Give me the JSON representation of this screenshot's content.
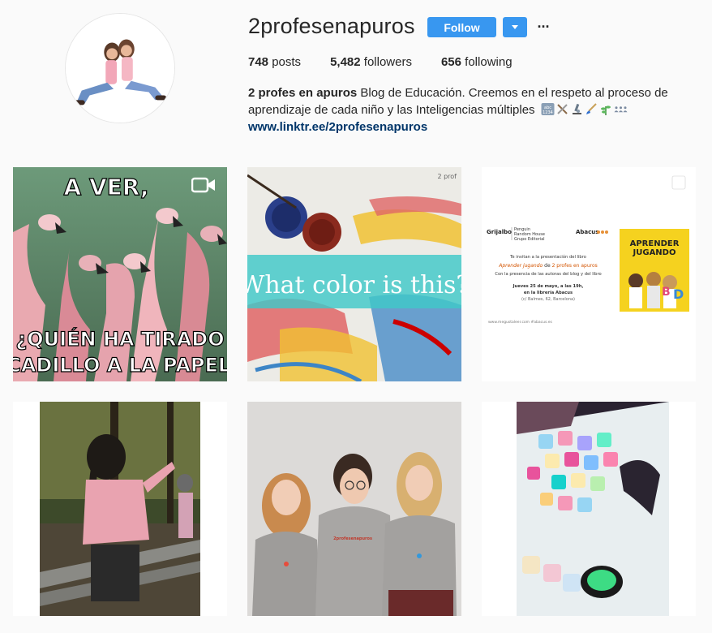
{
  "profile": {
    "username": "2profesenapuros",
    "follow_label": "Follow",
    "more_label": "···",
    "stats": {
      "posts_count": "748",
      "posts_label": "posts",
      "followers_count": "5,482",
      "followers_label": "followers",
      "following_count": "656",
      "following_label": "following"
    },
    "bio": {
      "name": "2 profes en apuros",
      "line1": "Blog de Educación. Creemos en el respeto al proceso de",
      "line2": "aprendizaje de cada niño y las Inteligencias múltiples",
      "link": "www.linktr.ee/2profesenapuros",
      "emoji_icons": [
        "abc-1234-icon",
        "crossed-tools-icon",
        "microscope-icon",
        "paintbrush-icon",
        "herb-icon",
        "people-icon"
      ]
    }
  },
  "colors": {
    "accent": "#3897f0",
    "link": "#003569",
    "background": "#fafafa",
    "text": "#262626"
  },
  "posts": [
    {
      "type": "video",
      "caption_top": "A VER,",
      "caption_bottom_1": "¿QUIÉN HA TIRADO",
      "caption_bottom_2": "OCADILLO A LA PAPEL"
    },
    {
      "type": "image",
      "overlay_text": "What color is this?",
      "corner_text": "2 prof"
    },
    {
      "type": "carousel",
      "publisher_1": "Grijalbo",
      "publisher_2a": "Penguin",
      "publisher_2b": "Random House",
      "publisher_2c": "Grupo Editorial",
      "publisher_3": "Abacus",
      "invite": "Te invitan a la presentación del libro",
      "book_line_title": "Aprender jugando",
      "book_line_de": "de",
      "book_line_authors": "2 profes en apuros",
      "presence": "Con la presencia de las autoras del blog y del libro",
      "date": "Jueves 25 de mayo, a las 19h,",
      "venue": "en la librería Abacus",
      "address": "(c/ Balmes, 62, Barcelona)",
      "footer": "www.megustaleer.com   #abacus.es",
      "book_cover_title_1": "APRENDER",
      "book_cover_title_2": "JUGANDO"
    },
    {
      "type": "image"
    },
    {
      "type": "image",
      "badge": "2profesenapuros"
    },
    {
      "type": "image"
    }
  ]
}
